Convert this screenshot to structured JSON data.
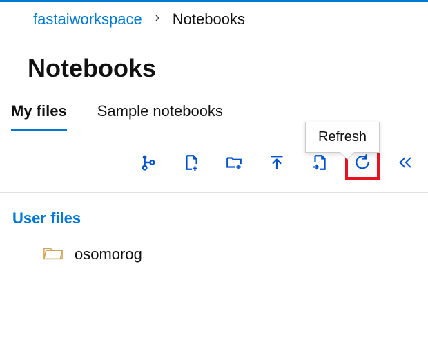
{
  "breadcrumb": {
    "workspace": "fastaiworkspace",
    "current": "Notebooks"
  },
  "page_title": "Notebooks",
  "tabs": {
    "my_files": "My files",
    "sample": "Sample notebooks"
  },
  "tooltip": {
    "refresh": "Refresh"
  },
  "tree": {
    "header": "User files",
    "items": [
      {
        "label": "osomorog"
      }
    ]
  },
  "colors": {
    "accent": "#0078d4",
    "highlight": "#e81123"
  }
}
